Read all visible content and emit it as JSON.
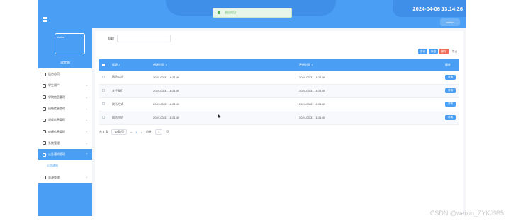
{
  "header": {
    "datetime": "2024-04-06 13:14:26",
    "user_button": "admin",
    "toast": "退出成功"
  },
  "sidebar": {
    "avatar_alt": "avatar",
    "username": "admin",
    "items": [
      {
        "label": "后台首页",
        "icon": "home-icon"
      },
      {
        "label": "学生用户",
        "icon": "monitor-icon"
      },
      {
        "label": "学院信息管理",
        "icon": "doc-icon"
      },
      {
        "label": "班级信息管理",
        "icon": "tag-icon"
      },
      {
        "label": "课程信息管理",
        "icon": "gear-icon"
      },
      {
        "label": "成绩信息管理",
        "icon": "disk-icon"
      },
      {
        "label": "系统管理",
        "icon": "book-icon"
      },
      {
        "label": "公告通知管理",
        "icon": "monitor-icon"
      },
      {
        "label": "资源管理",
        "icon": "table-icon"
      }
    ],
    "active_sub": "公告通知"
  },
  "search": {
    "label": "标题"
  },
  "toolbar": {
    "search": "查询",
    "add": "新增",
    "delete": "删除",
    "extra": "导出"
  },
  "table": {
    "headers": [
      "标题 ↕",
      "新增时间 ↕",
      "更新时间 ↕",
      "操作"
    ],
    "rows": [
      {
        "title": "网站公告",
        "created": "2024-03-31 18:21:49",
        "updated": "2024-03-31 18:21:49",
        "action": "详情"
      },
      {
        "title": "关于我们",
        "created": "2024-03-31 18:21:49",
        "updated": "2024-03-31 18:21:49",
        "action": "详情"
      },
      {
        "title": "联系方式",
        "created": "2024-03-31 18:21:49",
        "updated": "2024-03-31 18:21:49",
        "action": "详情"
      },
      {
        "title": "网站介绍",
        "created": "2024-03-31 18:21:49",
        "updated": "2024-03-31 18:21:49",
        "action": "详情"
      }
    ]
  },
  "pager": {
    "total": "共 4 条",
    "per_page": "10条/页",
    "prev": "<",
    "current": "1",
    "next": ">",
    "goto": "前往",
    "goto_value": "1",
    "page_unit": "页"
  },
  "watermark": "CSDN @weixin_ZYKJ985"
}
